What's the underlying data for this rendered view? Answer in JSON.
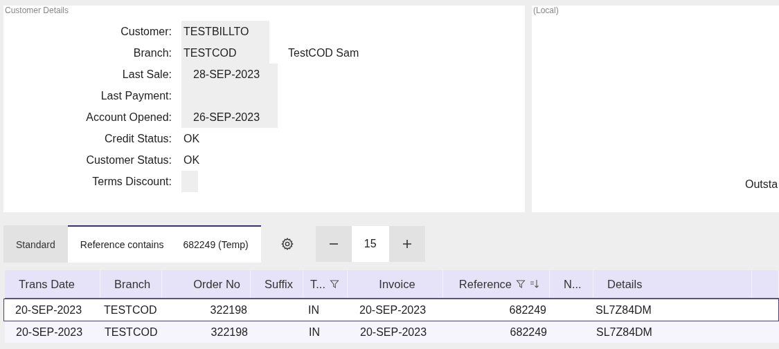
{
  "customer_panel": {
    "title": "Customer Details",
    "fields": [
      {
        "label": "Customer:",
        "value": "TESTBILLTO",
        "kind": "code"
      },
      {
        "label": "Branch:",
        "value": "TESTCOD",
        "kind": "code",
        "note": "TestCOD Sam"
      },
      {
        "label": "Last Sale:",
        "value": "28-SEP-2023",
        "kind": "date"
      },
      {
        "label": "Last Payment:",
        "kind": "date"
      },
      {
        "label": "Account Opened:",
        "value": "26-SEP-2023",
        "kind": "date"
      },
      {
        "label": "Credit Status:",
        "value": "OK",
        "kind": "plain"
      },
      {
        "label": "Customer Status:",
        "value": "OK",
        "kind": "plain"
      },
      {
        "label": "Terms Discount:",
        "kind": "tiny"
      }
    ]
  },
  "local_panel": {
    "title": "(Local)",
    "cut_label": "Outsta"
  },
  "tabs": [
    {
      "label": "Standard",
      "selected": false
    },
    {
      "label": "Reference contains",
      "value": "682249 (Temp)",
      "selected": true
    }
  ],
  "page_size": "15",
  "table": {
    "columns": [
      {
        "label": "Trans Date"
      },
      {
        "label": "Branch"
      },
      {
        "label": "Order No"
      },
      {
        "label": "Suffix"
      },
      {
        "label": "T...",
        "filter": true
      },
      {
        "label": "Invoice"
      },
      {
        "label": "Reference",
        "filter": true,
        "sort": true
      },
      {
        "label": "N..."
      },
      {
        "label": "Details"
      }
    ],
    "rows": [
      {
        "selected": true,
        "cells": [
          "20-SEP-2023",
          "TESTCOD",
          "322198",
          "",
          "IN",
          "20-SEP-2023",
          "682249",
          "",
          "SL7Z84DM"
        ]
      },
      {
        "selected": false,
        "cells": [
          "20-SEP-2023",
          "TESTCOD",
          "322198",
          "",
          "IN",
          "20-SEP-2023",
          "682249",
          "",
          "SL7Z84DM"
        ]
      }
    ]
  }
}
